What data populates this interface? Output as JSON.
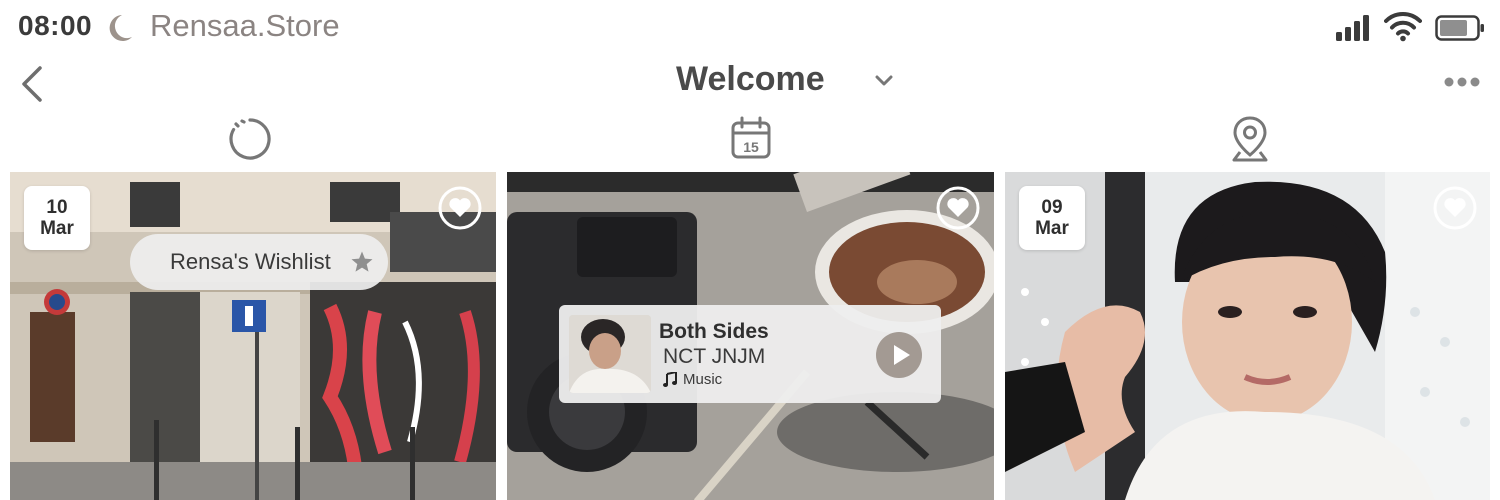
{
  "status_bar": {
    "time": "08:00",
    "moon_icon": "moon-icon",
    "site": "Rensaa.Store",
    "signal_icon": "cellular-signal-icon",
    "wifi_icon": "wifi-icon",
    "battery_icon": "battery-icon"
  },
  "nav": {
    "back_icon": "chevron-left-icon",
    "title": "Welcome",
    "title_chevron": "chevron-down-icon",
    "more_icon": "more-dots-icon"
  },
  "tabs": [
    {
      "icon": "loading-circle-icon"
    },
    {
      "icon": "calendar-icon",
      "calendar_day": "15"
    },
    {
      "icon": "location-pin-icon"
    }
  ],
  "cards": [
    {
      "date_day": "10",
      "date_month": "Mar",
      "favorite_icon": "heart-icon",
      "tag_label": "Rensa's Wishlist",
      "tag_icon": "star-icon"
    },
    {
      "favorite_icon": "heart-icon",
      "music": {
        "title": "Both Sides",
        "artist": "NCT JNJM",
        "source": "Music",
        "source_icon": "music-note-icon",
        "play_icon": "play-icon"
      }
    },
    {
      "date_day": "09",
      "date_month": "Mar",
      "favorite_icon": "heart-icon"
    }
  ],
  "colors": {
    "text_dark": "#3d3d3d",
    "text_muted": "#8b8482",
    "accent_brown": "#9d938c",
    "badge_bg": "#ffffff"
  }
}
